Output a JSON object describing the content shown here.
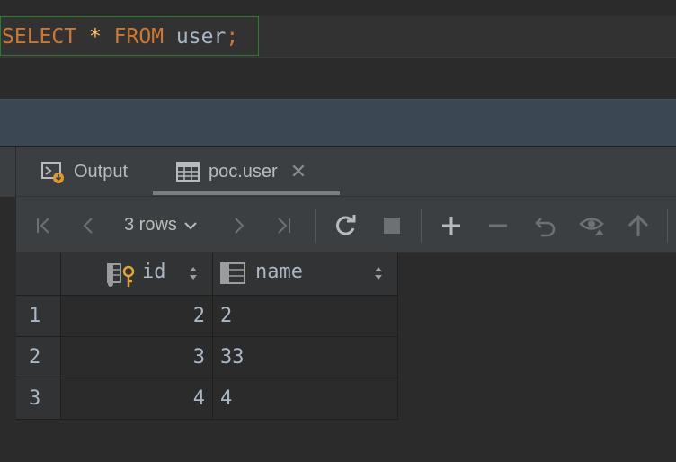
{
  "editor": {
    "sql": {
      "select": "SELECT",
      "star": "*",
      "from": "FROM",
      "table": "user",
      "semicolon": ";"
    }
  },
  "tabs": [
    {
      "label": "Output",
      "icon": "console-output-icon"
    },
    {
      "label": "poc.user",
      "icon": "table-grid-icon",
      "closable": true
    }
  ],
  "toolbar": {
    "rows_label": "3 rows",
    "buttons": [
      "first-page",
      "previous-page",
      "next-page",
      "last-page",
      "reload",
      "stop",
      "add-row",
      "delete-row",
      "revert",
      "preview-changes",
      "submit"
    ]
  },
  "grid": {
    "columns": [
      {
        "name": "id",
        "icon": "primary-key-column-icon"
      },
      {
        "name": "name",
        "icon": "column-icon"
      }
    ],
    "rows": [
      {
        "num": "1",
        "id": "2",
        "name": "2"
      },
      {
        "num": "2",
        "id": "3",
        "name": "33"
      },
      {
        "num": "3",
        "id": "4",
        "name": "4"
      }
    ]
  },
  "colors": {
    "keyword": "#cc7832",
    "star": "#ffc66d",
    "identifier": "#a9b7c6",
    "statement_border": "#2b7d2b",
    "panel_bg": "#3c3f41",
    "editor_bg": "#2b2b2b",
    "band_blue": "#3c4754"
  }
}
